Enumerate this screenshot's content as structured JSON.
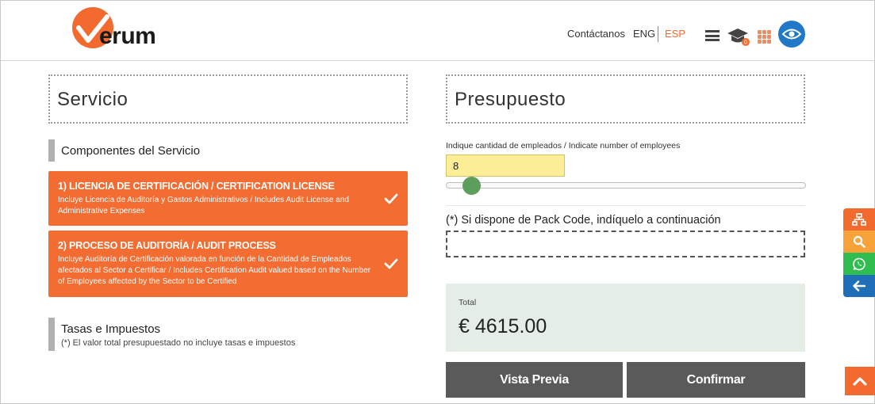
{
  "header": {
    "logo_text": "erum",
    "nav": {
      "contact": "Contáctanos",
      "lang_eng": "ENG",
      "lang_esp": "ESP"
    },
    "cap_badge": "0"
  },
  "servicio": {
    "title": "Servicio",
    "components_heading": "Componentes del Servicio",
    "components": [
      {
        "title": "1) LICENCIA DE CERTIFICACIÓN / CERTIFICATION LICENSE",
        "description": "Incluye Licencia de Auditoría y Gastos Administrativos / Includes Audit License and Administrative Expenses"
      },
      {
        "title": "2) PROCESO DE AUDITORÍA / AUDIT PROCESS",
        "description": "Incluye Auditoría de Certificación valorada en función de la Cantidad de Empleados afectados al Sector a Certificar / Includes Certification Audit valued based on the Number of Employees affected by the Sector to be Certified"
      }
    ],
    "taxes_heading": "Tasas e Impuestos",
    "taxes_note": "(*) El valor total presupuestado no incluye tasas e impuestos"
  },
  "presupuesto": {
    "title": "Presupuesto",
    "employees_label": "Indique cantidad de empleados / Indicate number of employees",
    "employees_value": "8",
    "slider_fraction": 0.05,
    "pack_code_label": "(*) Si dispone de Pack Code, indíquelo a continuación",
    "pack_code_value": "",
    "total_label": "Total",
    "total_value": "€ 4615.00",
    "preview_button": "Vista Previa",
    "confirm_button": "Confirmar"
  },
  "side_actions": [
    "sitemap-icon",
    "search-icon",
    "whatsapp-icon",
    "back-arrow-icon"
  ],
  "colors": {
    "brand_orange": "#f36c32",
    "button_gray": "#5a5a5a",
    "total_bg": "#e4ede6",
    "input_yellow": "#fbee96",
    "eye_blue": "#1f78c8"
  }
}
